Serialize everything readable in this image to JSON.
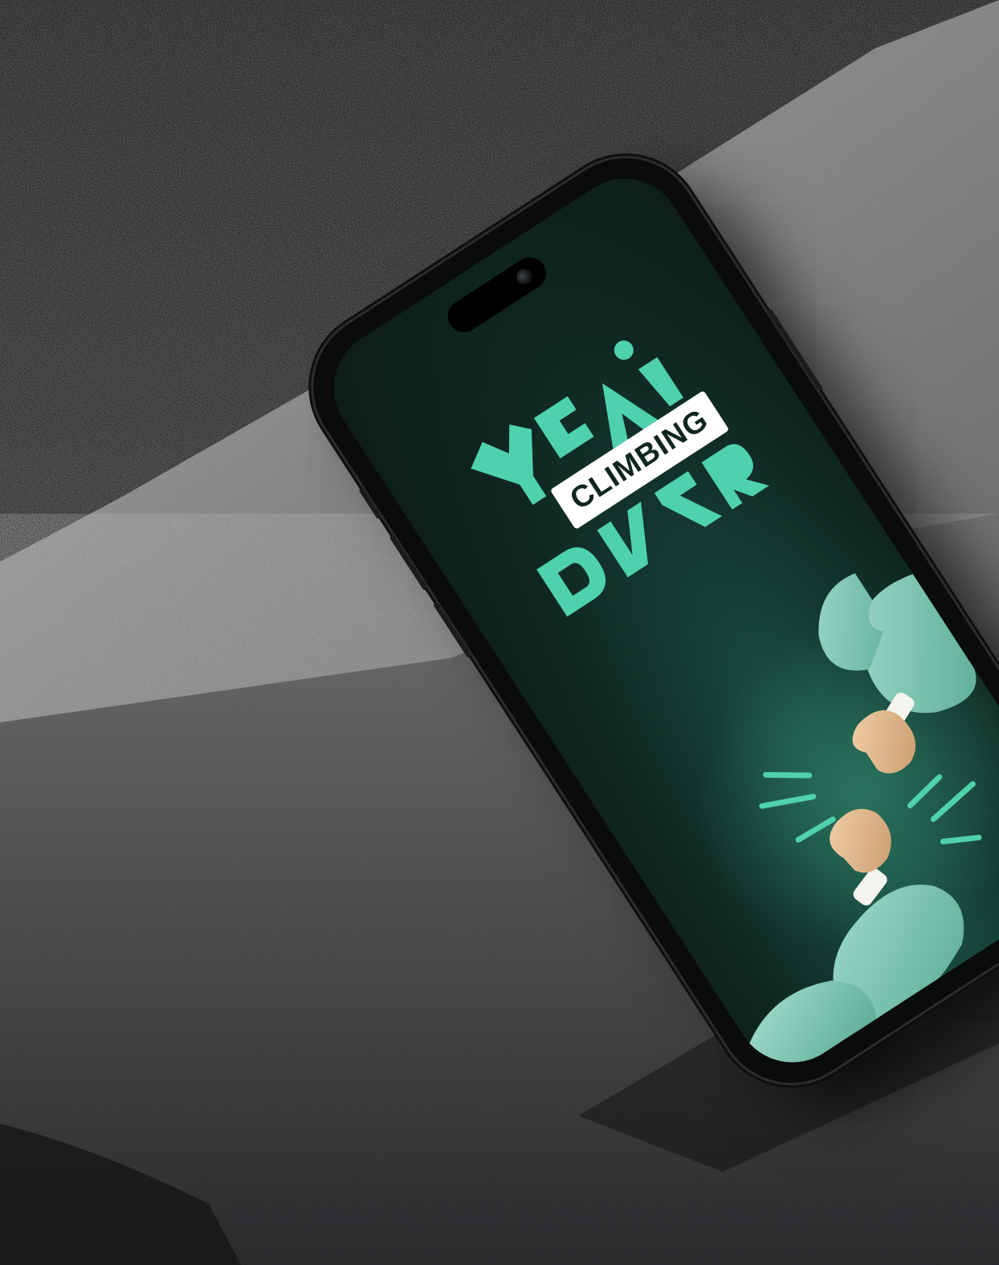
{
  "scene": {
    "subject": "phone-mockup",
    "background_colors": {
      "dark": "#111213",
      "rock": "#6a6b6d",
      "rock_light": "#a9aaac"
    }
  },
  "app": {
    "logo": {
      "word": "CLIMBING",
      "glyph_color": "#4fd1ad",
      "word_bg": "#ffffff"
    },
    "screen_colors": {
      "bg": "#0f2620",
      "accent": "#4fd1ad",
      "sleeve": "#7fc9b6",
      "skin": "#e3b98e"
    }
  }
}
